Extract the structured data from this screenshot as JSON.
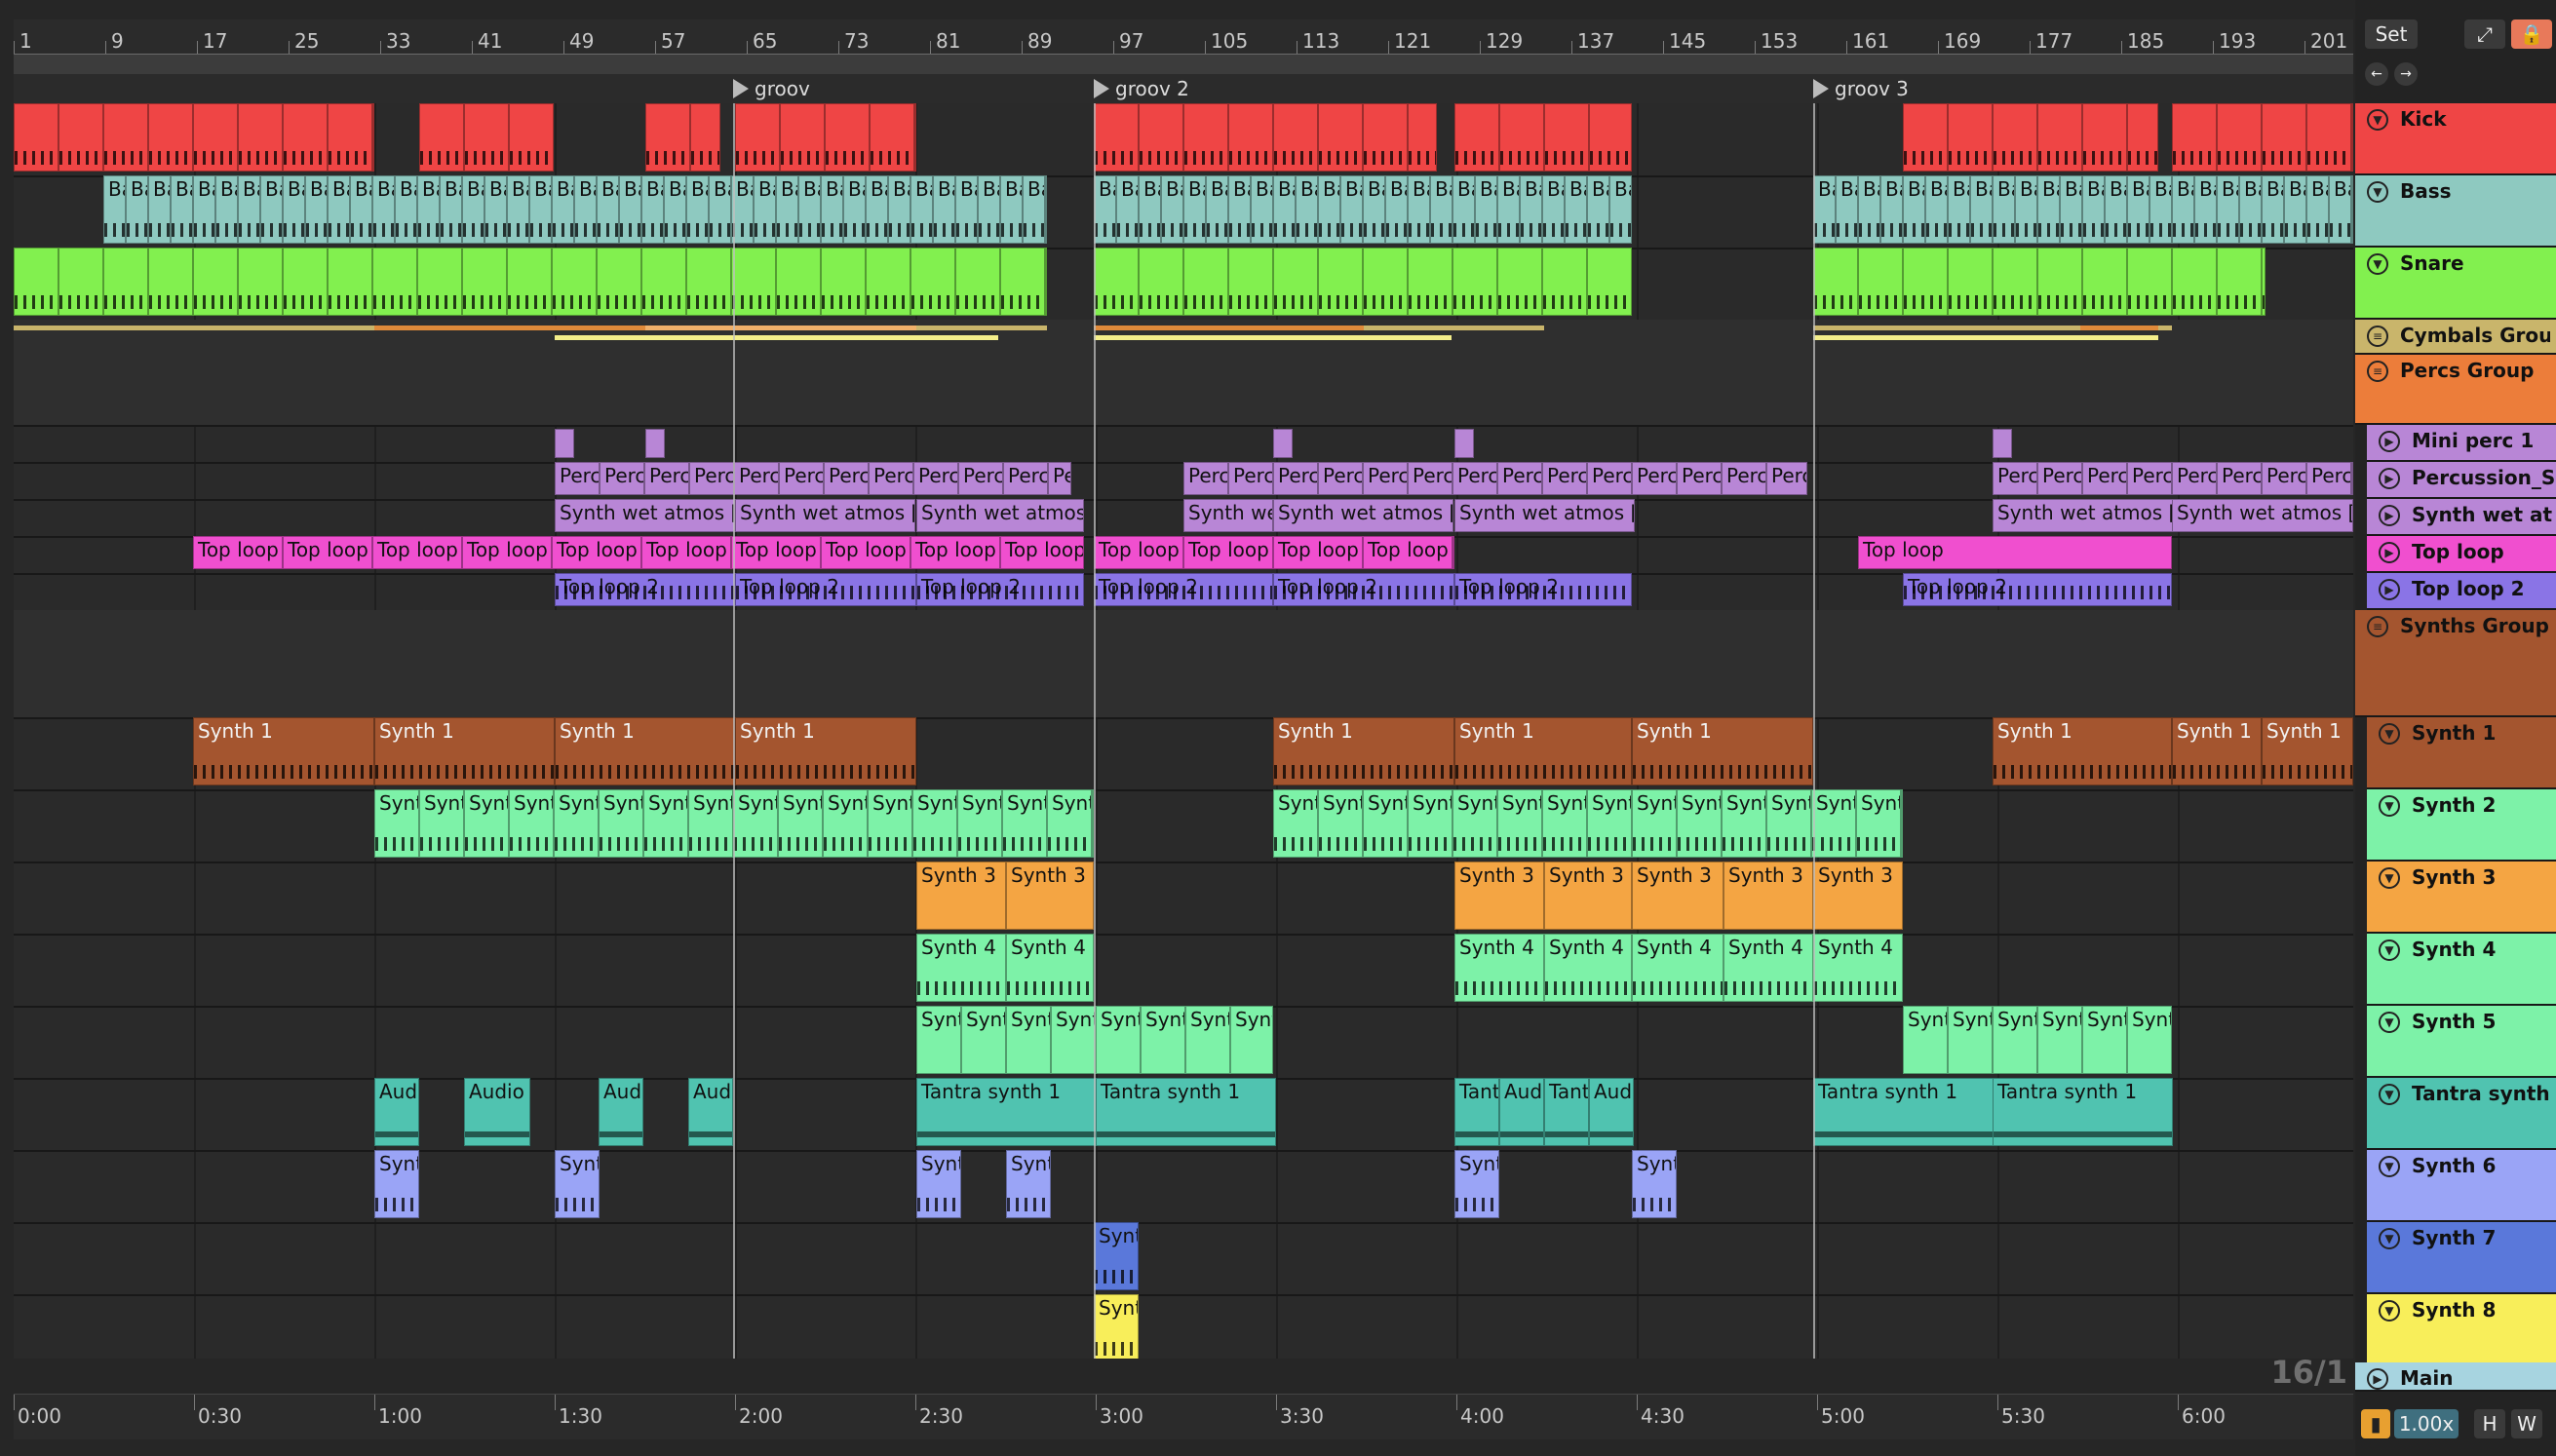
{
  "arrangement": {
    "beat_labels": [
      "1",
      "9",
      "17",
      "25",
      "33",
      "41",
      "49",
      "57",
      "65",
      "73",
      "81",
      "89",
      "97",
      "105",
      "113",
      "121",
      "129",
      "137",
      "145",
      "153",
      "161",
      "169",
      "177",
      "185",
      "193",
      "201"
    ],
    "time_labels": [
      "0:00",
      "0:30",
      "1:00",
      "1:30",
      "2:00",
      "2:30",
      "3:00",
      "3:30",
      "4:00",
      "4:30",
      "5:00",
      "5:30",
      "6:00"
    ],
    "locators": [
      {
        "label": "groov"
      },
      {
        "label": "groov 2"
      },
      {
        "label": "groov 3"
      }
    ],
    "grid_readout": "16/1"
  },
  "toolbar": {
    "set_label": "Set",
    "zoom_value": "1.00x",
    "h_label": "H",
    "w_label": "W"
  },
  "tracks": [
    {
      "name": "Kick",
      "color": "#ef4545",
      "type": "midi"
    },
    {
      "name": "Bass",
      "color": "#8ec9c0",
      "type": "midi"
    },
    {
      "name": "Snare",
      "color": "#82f04f",
      "type": "midi"
    },
    {
      "name": "Cymbals Grou",
      "color": "#c9b56b",
      "type": "group"
    },
    {
      "name": "Percs Group",
      "color": "#ec7d3a",
      "type": "group"
    },
    {
      "name": "Mini perc 1",
      "color": "#b886d6",
      "type": "audio"
    },
    {
      "name": "Percussion_S",
      "color": "#b886d6",
      "type": "audio"
    },
    {
      "name": "Synth wet at",
      "color": "#b886d6",
      "type": "audio"
    },
    {
      "name": "Top loop",
      "color": "#f04fcf",
      "type": "audio"
    },
    {
      "name": "Top loop 2",
      "color": "#8a74e6",
      "type": "audio"
    },
    {
      "name": "Synths Group",
      "color": "#a4552f",
      "type": "group"
    },
    {
      "name": "Synth 1",
      "color": "#a4552f",
      "type": "midi"
    },
    {
      "name": "Synth 2",
      "color": "#7df2a8",
      "type": "midi"
    },
    {
      "name": "Synth 3",
      "color": "#f4a543",
      "type": "midi"
    },
    {
      "name": "Synth 4",
      "color": "#7df2a8",
      "type": "midi"
    },
    {
      "name": "Synth 5",
      "color": "#7df2a8",
      "type": "midi"
    },
    {
      "name": "Tantra synth",
      "color": "#50c3b0",
      "type": "midi"
    },
    {
      "name": "Synth 6",
      "color": "#9aa4f6",
      "type": "midi"
    },
    {
      "name": "Synth 7",
      "color": "#5a78da",
      "type": "midi"
    },
    {
      "name": "Synth 8",
      "color": "#f8ee5a",
      "type": "midi"
    },
    {
      "name": "Main",
      "color": "#a7d4e0",
      "type": "main"
    }
  ],
  "clip_labels": {
    "bass": "Ba",
    "perc": "Perc",
    "synth_wet": "Synth wet atmos [",
    "synth_wet_short": "Synth we",
    "top_loop": "Top loop",
    "top_loop_2": "Top loop 2",
    "synth1": "Synth 1",
    "synth2": "Synt",
    "synth3": "Synth 3",
    "synth4": "Synth 4",
    "synth5": "Synt",
    "tantra": "Tantra synth 1",
    "tantra_short": "Tant",
    "audio": "Audio",
    "audio_short": "Aud",
    "synth6": "Synt",
    "synth7": "Synt",
    "synth8": "Synt"
  }
}
